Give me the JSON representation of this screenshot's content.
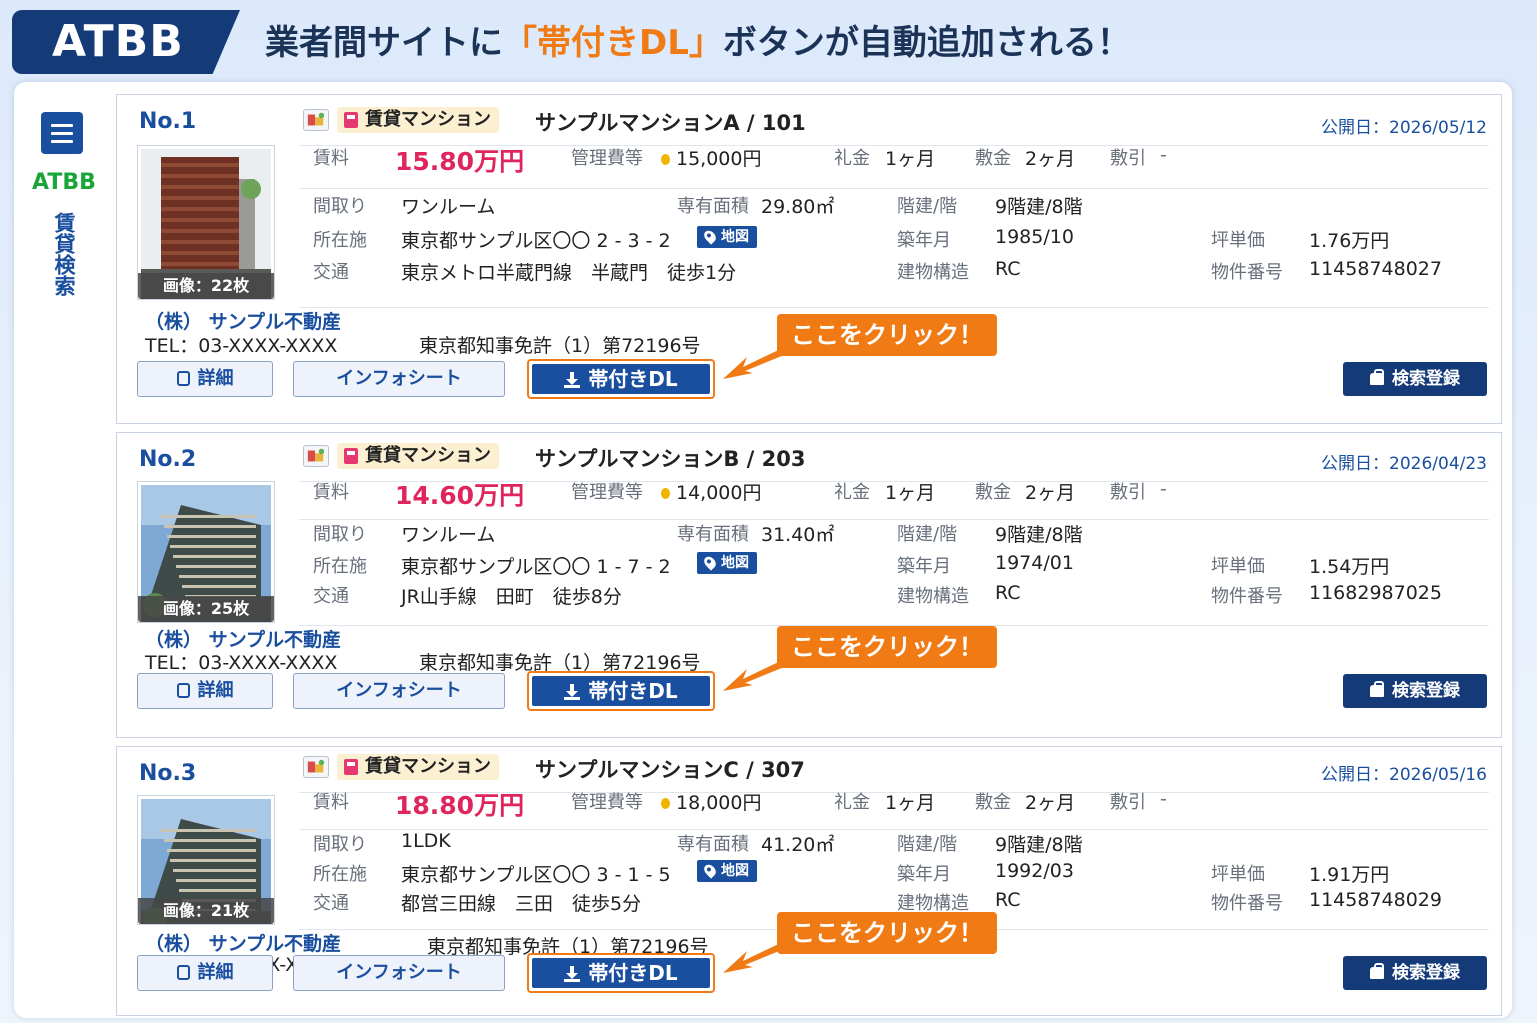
{
  "header": {
    "brand": "ATBB",
    "headline_pre": "業者間サイトに",
    "headline_hl": "「帯付きDL」",
    "headline_post": "ボタンが自動追加される！"
  },
  "sidebar": {
    "brand": "ATBB",
    "label": "賃貸検索"
  },
  "labels": {
    "rent": "賃料",
    "mgmt": "管理費等",
    "key_money": "礼金",
    "deposit": "敷金",
    "deduction": "敷引",
    "layout": "間取り",
    "area": "専有面積",
    "floors": "階建/階",
    "address": "所在施",
    "built": "築年月",
    "tsubo": "坪単価",
    "transport": "交通",
    "structure": "建物構造",
    "prop_no": "物件番号",
    "map": "地図",
    "detail_btn": "詳細",
    "info_btn": "インフォシート",
    "dl_btn": "帯付きDL",
    "search_btn": "検索登録",
    "callout": "ここをクリック！",
    "type": "賃貸マンション"
  },
  "listings": [
    {
      "no": "No.1",
      "name": "サンプルマンションA / 101",
      "pubdate": "公開日：2026/05/12",
      "images": "画像：22枚",
      "rent": "15.80万円",
      "mgmt": "15,000円",
      "key_money": "1ヶ月",
      "deposit": "2ヶ月",
      "deduction": "-",
      "layout": "ワンルーム",
      "area": "29.80㎡",
      "floors": "9階建/8階",
      "address": "東京都サンプル区〇〇 2 - 3 - 2",
      "built": "1985/10",
      "tsubo": "1.76万円",
      "transport": "東京メトロ半蔵門線　半蔵門　徒歩1分",
      "structure": "RC",
      "prop_no": "11458748027",
      "company": "（株） サンプル不動産",
      "tel": "TEL：03-XXXX-XXXX",
      "license": "東京都知事免許（1）第72196号"
    },
    {
      "no": "No.2",
      "name": "サンプルマンションB / 203",
      "pubdate": "公開日：2026/04/23",
      "images": "画像：25枚",
      "rent": "14.60万円",
      "mgmt": "14,000円",
      "key_money": "1ヶ月",
      "deposit": "2ヶ月",
      "deduction": "-",
      "layout": "ワンルーム",
      "area": "31.40㎡",
      "floors": "9階建/8階",
      "address": "東京都サンプル区〇〇 1 - 7 - 2",
      "built": "1974/01",
      "tsubo": "1.54万円",
      "transport": "JR山手線　田町　徒歩8分",
      "structure": "RC",
      "prop_no": "11682987025",
      "company": "（株） サンプル不動産",
      "tel": "TEL：03-XXXX-XXXX",
      "license": "東京都知事免許（1）第72196号"
    },
    {
      "no": "No.3",
      "name": "サンプルマンションC / 307",
      "pubdate": "公開日：2026/05/16",
      "images": "画像：21枚",
      "rent": "18.80万円",
      "mgmt": "18,000円",
      "key_money": "1ヶ月",
      "deposit": "2ヶ月",
      "deduction": "-",
      "layout": "1LDK",
      "area": "41.20㎡",
      "floors": "9階建/8階",
      "address": "東京都サンプル区〇〇 3 - 1 - 5",
      "built": "1992/03",
      "tsubo": "1.91万円",
      "transport": "都営三田線　三田　徒歩5分",
      "structure": "RC",
      "prop_no": "11458748029",
      "company": "（株） サンプル不動産",
      "tel": "TEL：03-XXXX-XXXX",
      "license": "東京都知事免許（1）第72196号"
    }
  ],
  "colors": {
    "brand_navy": "#143a78",
    "accent_orange": "#f07a14",
    "rent_red": "#e0245e",
    "link_blue": "#1a4fa0",
    "atbb_green": "#1aa53a"
  }
}
